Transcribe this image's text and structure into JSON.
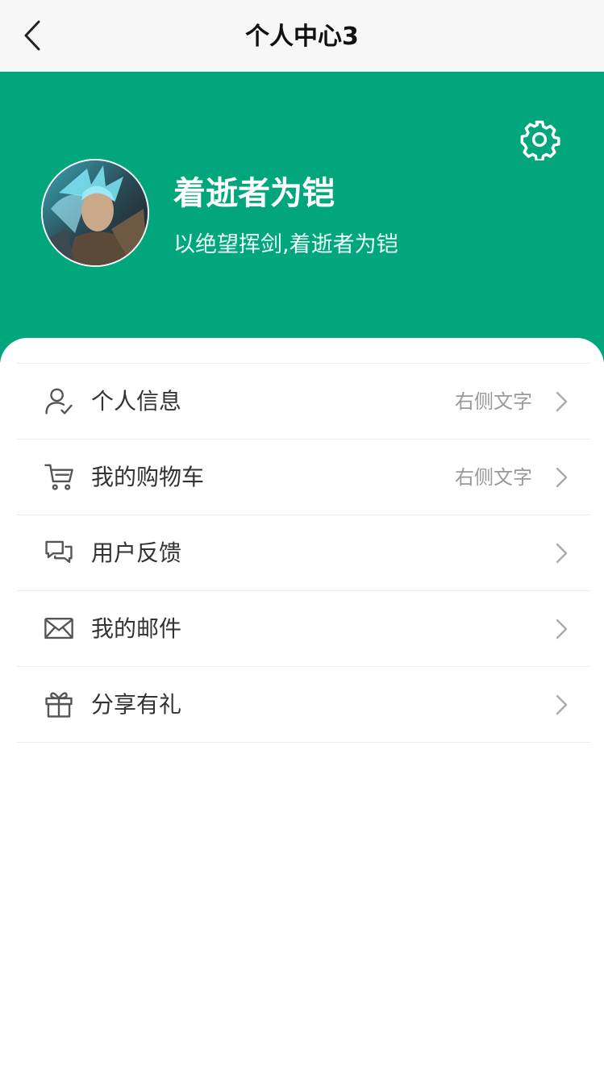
{
  "navbar": {
    "title": "个人中心3",
    "back_icon": "chevron-left-icon"
  },
  "profile": {
    "name": "着逝者为铠",
    "bio": "以绝望挥剑,着逝者为铠",
    "settings_icon": "gear-icon",
    "header_color": "#02a67c"
  },
  "menu": {
    "items": [
      {
        "label": "个人信息",
        "extra": "右侧文字",
        "icon": "user-check-icon"
      },
      {
        "label": "我的购物车",
        "extra": "右侧文字",
        "icon": "cart-icon"
      },
      {
        "label": "用户反馈",
        "extra": "",
        "icon": "chat-bubbles-icon"
      },
      {
        "label": "我的邮件",
        "extra": "",
        "icon": "mail-icon"
      },
      {
        "label": "分享有礼",
        "extra": "",
        "icon": "gift-icon"
      }
    ]
  }
}
